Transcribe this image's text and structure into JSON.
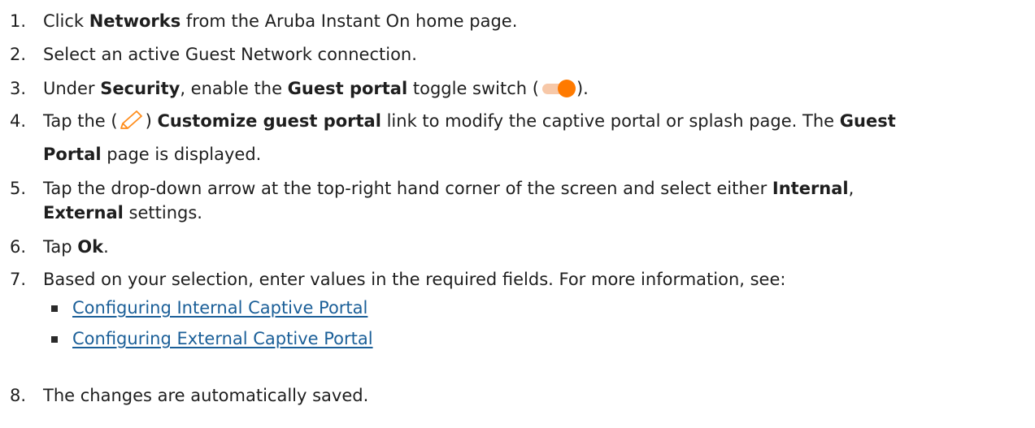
{
  "colors": {
    "link": "#1b5f98",
    "toggle_knob": "#ff7a00",
    "toggle_track": "#f7c8a8",
    "pencil": "#ff8c1a",
    "text": "#1e1e1e"
  },
  "icons": {
    "toggle": "toggle-switch-on-icon",
    "pencil": "pencil-edit-icon"
  },
  "steps": [
    {
      "num": "1.",
      "pre": "Click ",
      "b1": "Networks",
      "post": " from the Aruba Instant On home page."
    },
    {
      "num": "2.",
      "text": "Select an active Guest Network connection."
    },
    {
      "num": "3.",
      "pre": "Under ",
      "b1": "Security",
      "mid": ", enable the ",
      "b2": "Guest portal",
      "post": " toggle switch (",
      "end": ")."
    },
    {
      "num": "4.",
      "pre": "Tap the (",
      "mid": ") ",
      "b1": "Customize guest portal",
      "post": " link to modify the captive portal or splash page. The ",
      "b2": "Guest",
      "b3": "Portal",
      "end": " page is displayed."
    },
    {
      "num": "5.",
      "pre": "Tap the drop-down arrow at the top-right hand corner of the screen and select either ",
      "b1": "Internal",
      "mid": ",",
      "b2": "External",
      "end": " settings."
    },
    {
      "num": "6.",
      "pre": "Tap ",
      "b1": "Ok",
      "end": "."
    },
    {
      "num": "7.",
      "text": "Based on your selection, enter values in the required fields. For more information, see:"
    },
    {
      "num": "8.",
      "text": "The changes are automatically saved."
    }
  ],
  "links": [
    "Configuring Internal Captive Portal",
    "Configuring External Captive Portal"
  ]
}
